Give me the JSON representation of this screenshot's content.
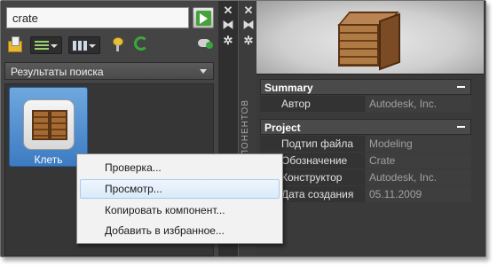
{
  "search": {
    "value": "crate"
  },
  "results": {
    "header_label": "Результаты поиска",
    "item": {
      "label": "Клеть"
    }
  },
  "palette_title": "КОМПОНЕНТОВ",
  "properties": {
    "summary": {
      "title": "Summary",
      "rows": [
        {
          "name": "Автор",
          "value": "Autodesk, Inc."
        }
      ]
    },
    "project": {
      "title": "Project",
      "rows": [
        {
          "name": "Подтип файла",
          "value": "Modeling"
        },
        {
          "name": "Обозначение",
          "value": "Crate"
        },
        {
          "name": "Конструктор",
          "value": "Autodesk, Inc."
        },
        {
          "name": "Дата создания",
          "value": "05.11.2009"
        }
      ]
    }
  },
  "context_menu": {
    "items": [
      {
        "label": "Проверка..."
      },
      {
        "label": "Просмотр..."
      },
      {
        "label": "Копировать компонент..."
      },
      {
        "label": "Добавить в избранное..."
      }
    ],
    "highlighted_index": 1
  },
  "colors": {
    "panel_bg": "#3b3b3b",
    "selection_blue": "#4a8ad0",
    "go_green": "#46a23a"
  }
}
